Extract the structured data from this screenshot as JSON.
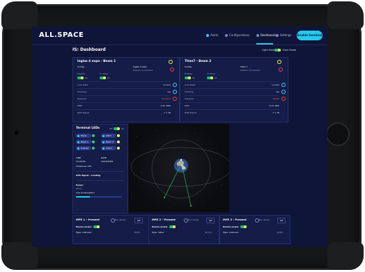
{
  "app": {
    "logo": "ALL.SPACE"
  },
  "nav": {
    "items": [
      {
        "label": "Alerts",
        "icon": "alert-icon"
      },
      {
        "label": "Configurations",
        "icon": "gear-icon"
      },
      {
        "label": "Dashboard",
        "icon": "dashboard-icon"
      },
      {
        "label": "Settings",
        "icon": "settings-icon"
      }
    ],
    "active": "Dashboard",
    "enable_button": "Enable terminal"
  },
  "page": {
    "title": "IS: Dashboard",
    "light_mode": "Light Mode",
    "dark_mode": "Dark Mode"
  },
  "beams": [
    {
      "title": "Inglas 4 expo - Beam 1",
      "config_label": "Config",
      "config_value": "Inglas 4 expo",
      "disable_label": "Disable",
      "tx_mute_label": "Tx Mute",
      "on": "On",
      "modem": "Modem Connection",
      "rows": [
        {
          "label": "Lock state",
          "value": "Locked"
        },
        {
          "label": "Tracking",
          "value": "Yes"
        },
        {
          "label": "Transmit",
          "value": "Transmit"
        },
        {
          "label": "EIRP",
          "value": "0.00 dBW"
        },
        {
          "label": "RSSI Signal",
          "value": "-7.1 dB"
        }
      ]
    },
    {
      "title": "Titan7 - Beam 2",
      "config_label": "Config",
      "config_value": "Titan 7",
      "disable_label": "Disable",
      "tx_mute_label": "Tx Mute",
      "on": "On",
      "modem": "Modem Connection",
      "rows": [
        {
          "label": "Lock state",
          "value": "Locked"
        },
        {
          "label": "Tracking",
          "value": "Yes"
        },
        {
          "label": "Transmit",
          "value": "Muted"
        },
        {
          "label": "EIRP",
          "value": "0.00 dBW"
        },
        {
          "label": "RSSI Signal",
          "value": "-7.1 dB"
        }
      ]
    }
  ],
  "terminal": {
    "title": "Terminal LEDs",
    "off": "Off",
    "on": "On",
    "leds": [
      "Power",
      "Alarm",
      "Beam 1",
      "Beam 2",
      "Enabled",
      "Indoor"
    ],
    "time_label": "TIME",
    "time_value": "13:24:53",
    "date_label": "DATE",
    "date_value": "10/10/2024",
    "timezone": "Timezone: UTC",
    "gps": "GPS Signal - Loading",
    "power_label": "Power",
    "power_value": "60 W",
    "low_consumption": "Low Consumption"
  },
  "mpes": [
    {
      "title": "MPE 1 - Present",
      "buc_power": "Buc Power",
      "off": "Off",
      "device_power": "Device power",
      "type": "Type: unknown",
      "value": "ROPC"
    },
    {
      "title": "MPE 2 - Present",
      "buc_power": "Buc Power",
      "off": "Off",
      "device_power": "Device power",
      "type": "Type: Inline",
      "value": "36.5°C"
    },
    {
      "title": "MPE 3 - Present",
      "buc_power": "Buc Power",
      "off": "Off",
      "device_power": "Device power",
      "type": "Type: unknown",
      "value": "ROPC"
    }
  ],
  "colors": {
    "accent": "#26c8f0",
    "bg": "#0f1538",
    "card": "#141c47",
    "ok": "#1fbf6a",
    "warn": "#ff3b3b",
    "highlight": "#e8ff5a"
  }
}
